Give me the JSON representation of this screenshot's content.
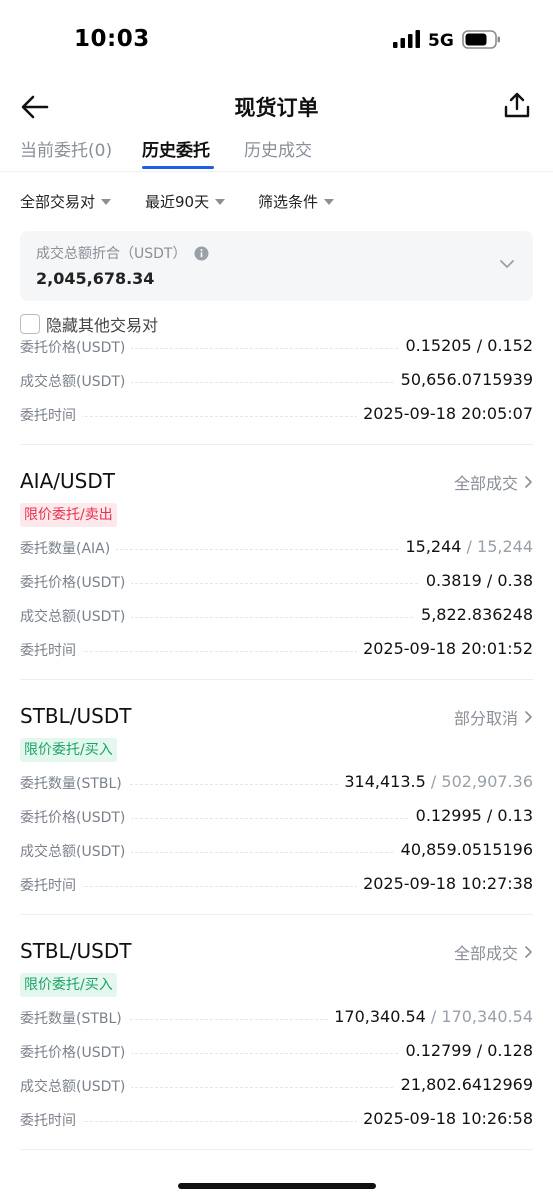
{
  "status_bar": {
    "time": "10:03",
    "network": "5G"
  },
  "nav": {
    "title": "现货订单"
  },
  "tabs": [
    {
      "label": "当前委托(0)"
    },
    {
      "label": "历史委托"
    },
    {
      "label": "历史成交"
    }
  ],
  "filters": [
    {
      "label": "全部交易对"
    },
    {
      "label": "最近90天"
    },
    {
      "label": "筛选条件"
    }
  ],
  "summary": {
    "label": "成交总额折合（USDT）",
    "value": "2,045,678.34"
  },
  "hide_others": {
    "label": "隐藏其他交易对"
  },
  "partial_order": {
    "rows": [
      {
        "label": "委托价格(USDT)",
        "value": "0.15205 / 0.152"
      },
      {
        "label": "成交总额(USDT)",
        "value": "50,656.0715939"
      },
      {
        "label": "委托时间",
        "value": "2025-09-18 20:05:07"
      }
    ]
  },
  "orders": [
    {
      "pair": "AIA/USDT",
      "status": "全部成交",
      "tag": "限价委托/卖出",
      "qty_label": "委托数量(AIA)",
      "qty_filled": "15,244",
      "qty_total": "/ 15,244",
      "price_label": "委托价格(USDT)",
      "price": "0.3819 / 0.38",
      "total_label": "成交总额(USDT)",
      "total": "5,822.836248",
      "time_label": "委托时间",
      "time": "2025-09-18 20:01:52"
    },
    {
      "pair": "STBL/USDT",
      "status": "部分取消",
      "tag": "限价委托/买入",
      "qty_label": "委托数量(STBL)",
      "qty_filled": "314,413.5",
      "qty_total": "/ 502,907.36",
      "price_label": "委托价格(USDT)",
      "price": "0.12995 / 0.13",
      "total_label": "成交总额(USDT)",
      "total": "40,859.0515196",
      "time_label": "委托时间",
      "time": "2025-09-18 10:27:38"
    },
    {
      "pair": "STBL/USDT",
      "status": "全部成交",
      "tag": "限价委托/买入",
      "qty_label": "委托数量(STBL)",
      "qty_filled": "170,340.54",
      "qty_total": "/ 170,340.54",
      "price_label": "委托价格(USDT)",
      "price": "0.12799 / 0.128",
      "total_label": "成交总额(USDT)",
      "total": "21,802.6412969",
      "time_label": "委托时间",
      "time": "2025-09-18 10:26:58"
    }
  ],
  "colors": {
    "accent": "#1f5ee8",
    "sell": "#e8304e",
    "buy": "#1ba465"
  }
}
